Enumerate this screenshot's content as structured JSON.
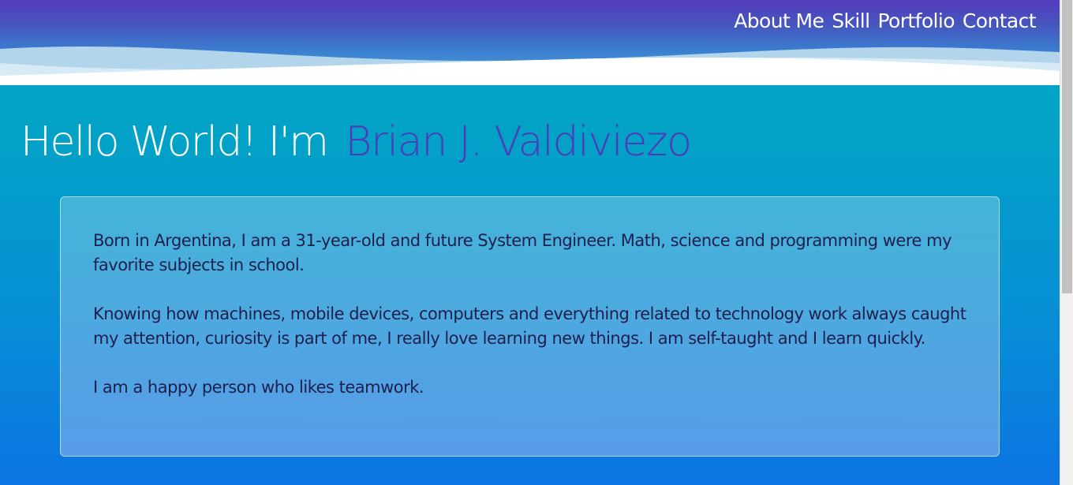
{
  "nav": {
    "items": [
      {
        "label": "About Me"
      },
      {
        "label": "Skill"
      },
      {
        "label": "Portfolio"
      },
      {
        "label": "Contact"
      }
    ]
  },
  "hero": {
    "greeting": "Hello World! I'm",
    "name": "Brian J. Valdiviezo"
  },
  "about": {
    "paragraphs": [
      "Born in Argentina, I am a 31-year-old and future System Engineer. Math, science and programming were my favorite subjects in school.",
      "Knowing how machines, mobile devices, computers and everything related to technology work always caught my attention, curiosity is part of me, I really love learning new things. I am self-taught and I learn quickly.",
      "I am a happy person who likes teamwork."
    ]
  },
  "colors": {
    "name_accent": "#4d3bb8",
    "header_top": "#533bbd",
    "page_top": "#03abc3",
    "page_bottom": "#0c74e3",
    "body_text": "#1d1f4d"
  }
}
